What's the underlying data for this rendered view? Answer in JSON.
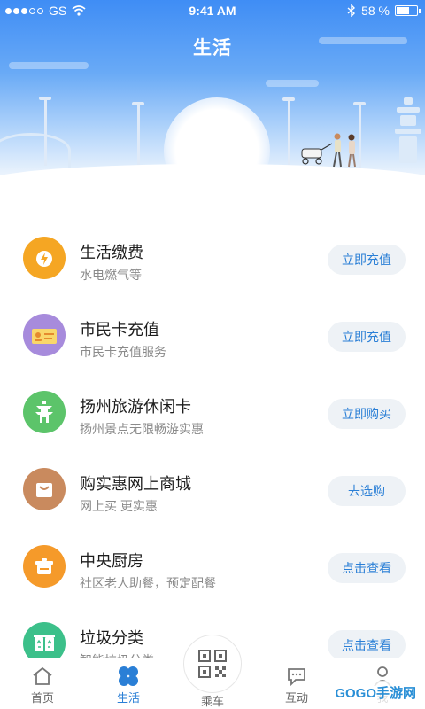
{
  "status": {
    "carrier": "GS",
    "time": "9:41 AM",
    "battery": "58 %",
    "battery_level": 0.58
  },
  "page": {
    "title": "生活"
  },
  "items": [
    {
      "title": "生活缴费",
      "subtitle": "水电燃气等",
      "button": "立即充值",
      "icon": "bolt-icon",
      "color": "#f5a623"
    },
    {
      "title": "市民卡充值",
      "subtitle": "市民卡充值服务",
      "button": "立即充值",
      "icon": "id-card-icon",
      "color": "#a78bdc"
    },
    {
      "title": "扬州旅游休闲卡",
      "subtitle": "扬州景点无限畅游实惠",
      "button": "立即购买",
      "icon": "pagoda-icon",
      "color": "#5cc46a"
    },
    {
      "title": "购实惠网上商城",
      "subtitle": "网上买  更实惠",
      "button": "去选购",
      "icon": "shopping-bag-icon",
      "color": "#c98a5e"
    },
    {
      "title": "中央厨房",
      "subtitle": "社区老人助餐，预定配餐",
      "button": "点击查看",
      "icon": "pot-icon",
      "color": "#f59a2a"
    },
    {
      "title": "垃圾分类",
      "subtitle": "智能垃圾分类",
      "button": "点击查看",
      "icon": "recycle-bin-icon",
      "color": "#3cc08a"
    }
  ],
  "tabs": {
    "home": "首页",
    "life": "生活",
    "ride": "乘车",
    "interact": "互动",
    "me": "我"
  },
  "watermark": "GOGO手游网"
}
